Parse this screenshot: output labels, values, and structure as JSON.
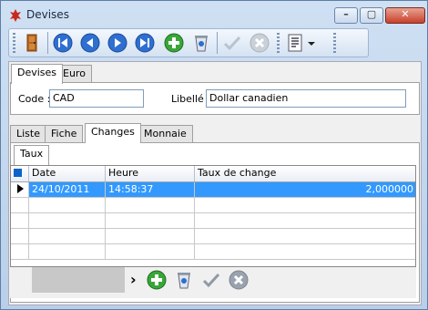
{
  "window": {
    "title": "Devises"
  },
  "caption_buttons": {
    "minimize": "–",
    "maximize": "▢",
    "close": "✕"
  },
  "toolbar": {
    "buttons": [
      "exit-door-icon",
      "first-record-icon",
      "previous-record-icon",
      "next-record-icon",
      "last-record-icon",
      "add-icon",
      "delete-icon",
      "validate-icon",
      "cancel-icon",
      "report-icon",
      "dropdown-arrow-icon"
    ]
  },
  "top_tabs": [
    {
      "label": "Devises"
    },
    {
      "label": "Euro"
    }
  ],
  "fields": {
    "code_label": "Code :",
    "code_value": "CAD",
    "libelle_label": "Libellé :",
    "libelle_value": "Dollar canadien"
  },
  "sub_tabs": [
    {
      "label": "Liste"
    },
    {
      "label": "Fiche"
    },
    {
      "label": "Changes"
    },
    {
      "label": "Monnaie"
    }
  ],
  "inner_tab": {
    "label": "Taux"
  },
  "grid": {
    "columns": [
      "Date",
      "Heure",
      "Taux de change"
    ],
    "rows": [
      {
        "date": "24/10/2011",
        "heure": "14:58:37",
        "taux": "2,000000"
      }
    ]
  },
  "grid_nav": {
    "next_arrow": "›"
  },
  "colors": {
    "selection": "#3399ff",
    "accent": "#0b63c9"
  }
}
